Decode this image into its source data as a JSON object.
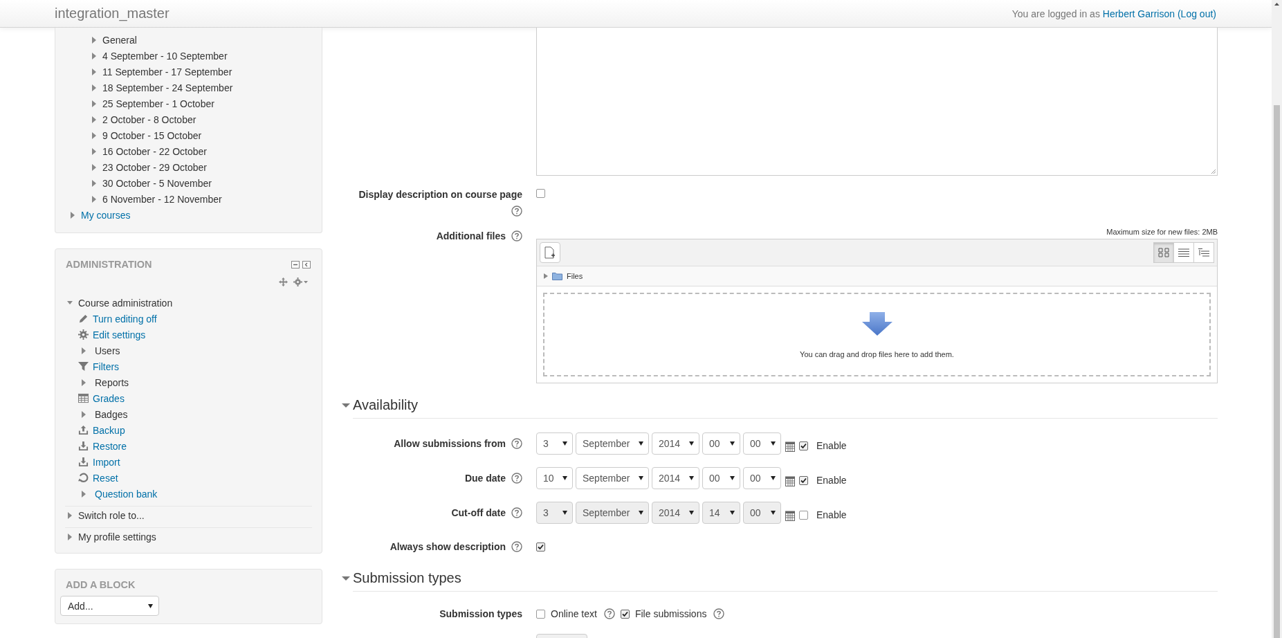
{
  "header": {
    "site_name": "integration_master",
    "login_prefix": "You are logged in as",
    "user": "Herbert Garrison",
    "logout": "(Log out)"
  },
  "navigation": {
    "sections": [
      {
        "label": "General",
        "expanded": false
      },
      {
        "label": "4 September - 10 September",
        "expanded": false
      },
      {
        "label": "11 September - 17 September",
        "expanded": false
      },
      {
        "label": "18 September - 24 September",
        "expanded": false
      },
      {
        "label": "25 September - 1 October",
        "expanded": false
      },
      {
        "label": "2 October - 8 October",
        "expanded": false
      },
      {
        "label": "9 October - 15 October",
        "expanded": false
      },
      {
        "label": "16 October - 22 October",
        "expanded": false
      },
      {
        "label": "23 October - 29 October",
        "expanded": false
      },
      {
        "label": "30 October - 5 November",
        "expanded": false
      },
      {
        "label": "6 November - 12 November",
        "expanded": false
      }
    ],
    "my_courses": {
      "label": "My courses",
      "expanded": false
    }
  },
  "administration": {
    "title": "ADMINISTRATION",
    "items": [
      {
        "label": "Course administration",
        "expanded": true,
        "children": [
          {
            "label": "Turn editing off",
            "kind": "pencil",
            "link": true
          },
          {
            "label": "Edit settings",
            "kind": "gear",
            "link": true
          },
          {
            "label": "Users",
            "kind": "caret",
            "link": false,
            "expanded": false
          },
          {
            "label": "Filters",
            "kind": "filter",
            "link": true
          },
          {
            "label": "Reports",
            "kind": "caret",
            "link": false,
            "expanded": false
          },
          {
            "label": "Grades",
            "kind": "table",
            "link": true
          },
          {
            "label": "Badges",
            "kind": "caret",
            "link": false,
            "expanded": false
          },
          {
            "label": "Backup",
            "kind": "upload",
            "link": true
          },
          {
            "label": "Restore",
            "kind": "download",
            "link": true
          },
          {
            "label": "Import",
            "kind": "download",
            "link": true
          },
          {
            "label": "Reset",
            "kind": "reset",
            "link": true
          },
          {
            "label": "Question bank",
            "kind": "caret",
            "link": true,
            "expanded": false
          }
        ]
      },
      {
        "label": "Switch role to...",
        "expanded": false
      },
      {
        "label": "My profile settings",
        "expanded": false
      }
    ]
  },
  "add_block": {
    "title": "ADD A BLOCK",
    "select": "Add..."
  },
  "form": {
    "general_fields": [
      {
        "kind": "checkbox",
        "label": "Display description on course page",
        "help": true,
        "checked": false
      },
      {
        "kind": "filepicker",
        "label": "Additional files",
        "help": true,
        "max_size": "Maximum size for new files: 2MB",
        "folder": "Files",
        "drop_hint": "You can drag and drop files here to add them.",
        "views": [
          {
            "selected": true
          },
          {
            "selected": false
          },
          {
            "selected": false
          }
        ]
      }
    ],
    "sections": [
      {
        "title": "Availability",
        "expanded": true,
        "fields": [
          {
            "kind": "datetime",
            "label": "Allow submissions from",
            "help": true,
            "day": "3",
            "month": "September",
            "year": "2014",
            "hour": "00",
            "minute": "00",
            "enabled": true,
            "enable_label": "Enable"
          },
          {
            "kind": "datetime",
            "label": "Due date",
            "help": true,
            "day": "10",
            "month": "September",
            "year": "2014",
            "hour": "00",
            "minute": "00",
            "enabled": true,
            "enable_label": "Enable"
          },
          {
            "kind": "datetime",
            "label": "Cut-off date",
            "help": true,
            "day": "3",
            "month": "September",
            "year": "2014",
            "hour": "14",
            "minute": "00",
            "enabled": false,
            "enable_label": "Enable"
          },
          {
            "kind": "checkbox",
            "label": "Always show description",
            "help": true,
            "checked": true
          }
        ]
      },
      {
        "title": "Submission types",
        "expanded": true,
        "fields": [
          {
            "kind": "options",
            "label": "Submission types",
            "options": [
              {
                "label": "Online text",
                "checked": false,
                "help": true
              },
              {
                "label": "File submissions",
                "checked": true,
                "help": true
              }
            ]
          }
        ]
      }
    ]
  }
}
